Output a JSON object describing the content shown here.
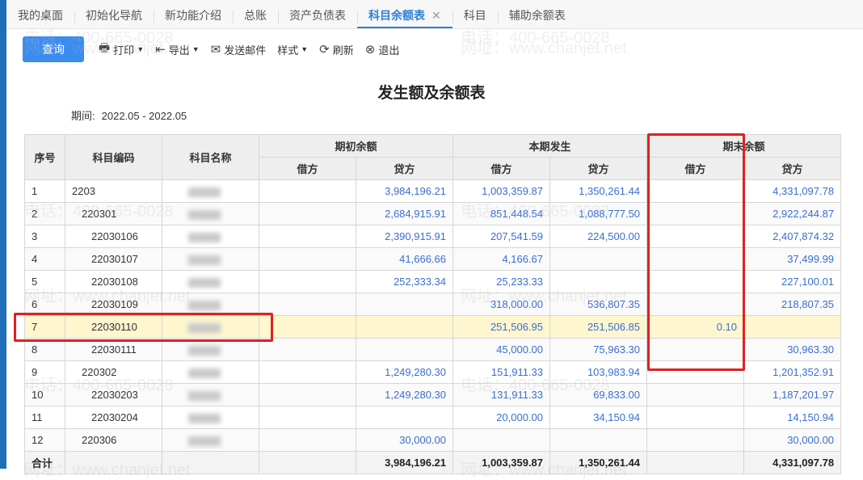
{
  "tabs": [
    {
      "label": "我的桌面"
    },
    {
      "label": "初始化导航"
    },
    {
      "label": "新功能介绍"
    },
    {
      "label": "总账"
    },
    {
      "label": "资产负债表"
    },
    {
      "label": "科目余额表",
      "active": true
    },
    {
      "label": "科目"
    },
    {
      "label": "辅助余额表"
    }
  ],
  "tab_close": "✕",
  "toolbar": {
    "query": "查询",
    "print": "打印",
    "export": "导出",
    "email": "发送邮件",
    "style": "样式",
    "refresh": "刷新",
    "exit": "退出"
  },
  "report": {
    "title": "发生额及余额表",
    "period_label": "期间:",
    "period_value": "2022.05 - 2022.05"
  },
  "headers": {
    "idx": "序号",
    "code": "科目编码",
    "name": "科目名称",
    "opening": "期初余额",
    "current": "本期发生",
    "ending": "期末余额",
    "debit": "借方",
    "credit": "贷方"
  },
  "rows": [
    {
      "idx": "1",
      "code": "2203",
      "indent": 0,
      "od": "",
      "oc": "3,984,196.21",
      "cd": "1,003,359.87",
      "cc": "1,350,261.44",
      "ed": "",
      "ec": "4,331,097.78"
    },
    {
      "idx": "2",
      "code": "220301",
      "indent": 1,
      "od": "",
      "oc": "2,684,915.91",
      "cd": "851,448.54",
      "cc": "1,088,777.50",
      "ed": "",
      "ec": "2,922,244.87"
    },
    {
      "idx": "3",
      "code": "22030106",
      "indent": 2,
      "od": "",
      "oc": "2,390,915.91",
      "cd": "207,541.59",
      "cc": "224,500.00",
      "ed": "",
      "ec": "2,407,874.32"
    },
    {
      "idx": "4",
      "code": "22030107",
      "indent": 2,
      "od": "",
      "oc": "41,666.66",
      "cd": "4,166.67",
      "cc": "",
      "ed": "",
      "ec": "37,499.99"
    },
    {
      "idx": "5",
      "code": "22030108",
      "indent": 2,
      "od": "",
      "oc": "252,333.34",
      "cd": "25,233.33",
      "cc": "",
      "ed": "",
      "ec": "227,100.01"
    },
    {
      "idx": "6",
      "code": "22030109",
      "indent": 2,
      "od": "",
      "oc": "",
      "cd": "318,000.00",
      "cc": "536,807.35",
      "ed": "",
      "ec": "218,807.35"
    },
    {
      "idx": "7",
      "code": "22030110",
      "indent": 2,
      "od": "",
      "oc": "",
      "cd": "251,506.95",
      "cc": "251,506.85",
      "ed": "0.10",
      "ec": "",
      "highlight": true
    },
    {
      "idx": "8",
      "code": "22030111",
      "indent": 2,
      "od": "",
      "oc": "",
      "cd": "45,000.00",
      "cc": "75,963.30",
      "ed": "",
      "ec": "30,963.30"
    },
    {
      "idx": "9",
      "code": "220302",
      "indent": 1,
      "od": "",
      "oc": "1,249,280.30",
      "cd": "151,911.33",
      "cc": "103,983.94",
      "ed": "",
      "ec": "1,201,352.91"
    },
    {
      "idx": "10",
      "code": "22030203",
      "indent": 2,
      "od": "",
      "oc": "1,249,280.30",
      "cd": "131,911.33",
      "cc": "69,833.00",
      "ed": "",
      "ec": "1,187,201.97"
    },
    {
      "idx": "11",
      "code": "22030204",
      "indent": 2,
      "od": "",
      "oc": "",
      "cd": "20,000.00",
      "cc": "34,150.94",
      "ed": "",
      "ec": "14,150.94"
    },
    {
      "idx": "12",
      "code": "220306",
      "indent": 1,
      "od": "",
      "oc": "30,000.00",
      "cd": "",
      "cc": "",
      "ed": "",
      "ec": "30,000.00"
    }
  ],
  "total": {
    "label": "合计",
    "od": "",
    "oc": "3,984,196.21",
    "cd": "1,003,359.87",
    "cc": "1,350,261.44",
    "ed": "",
    "ec": "4,331,097.78"
  },
  "watermark": {
    "phone": "电话：400-665-0028",
    "site": "网址：www.chanjet.net"
  }
}
